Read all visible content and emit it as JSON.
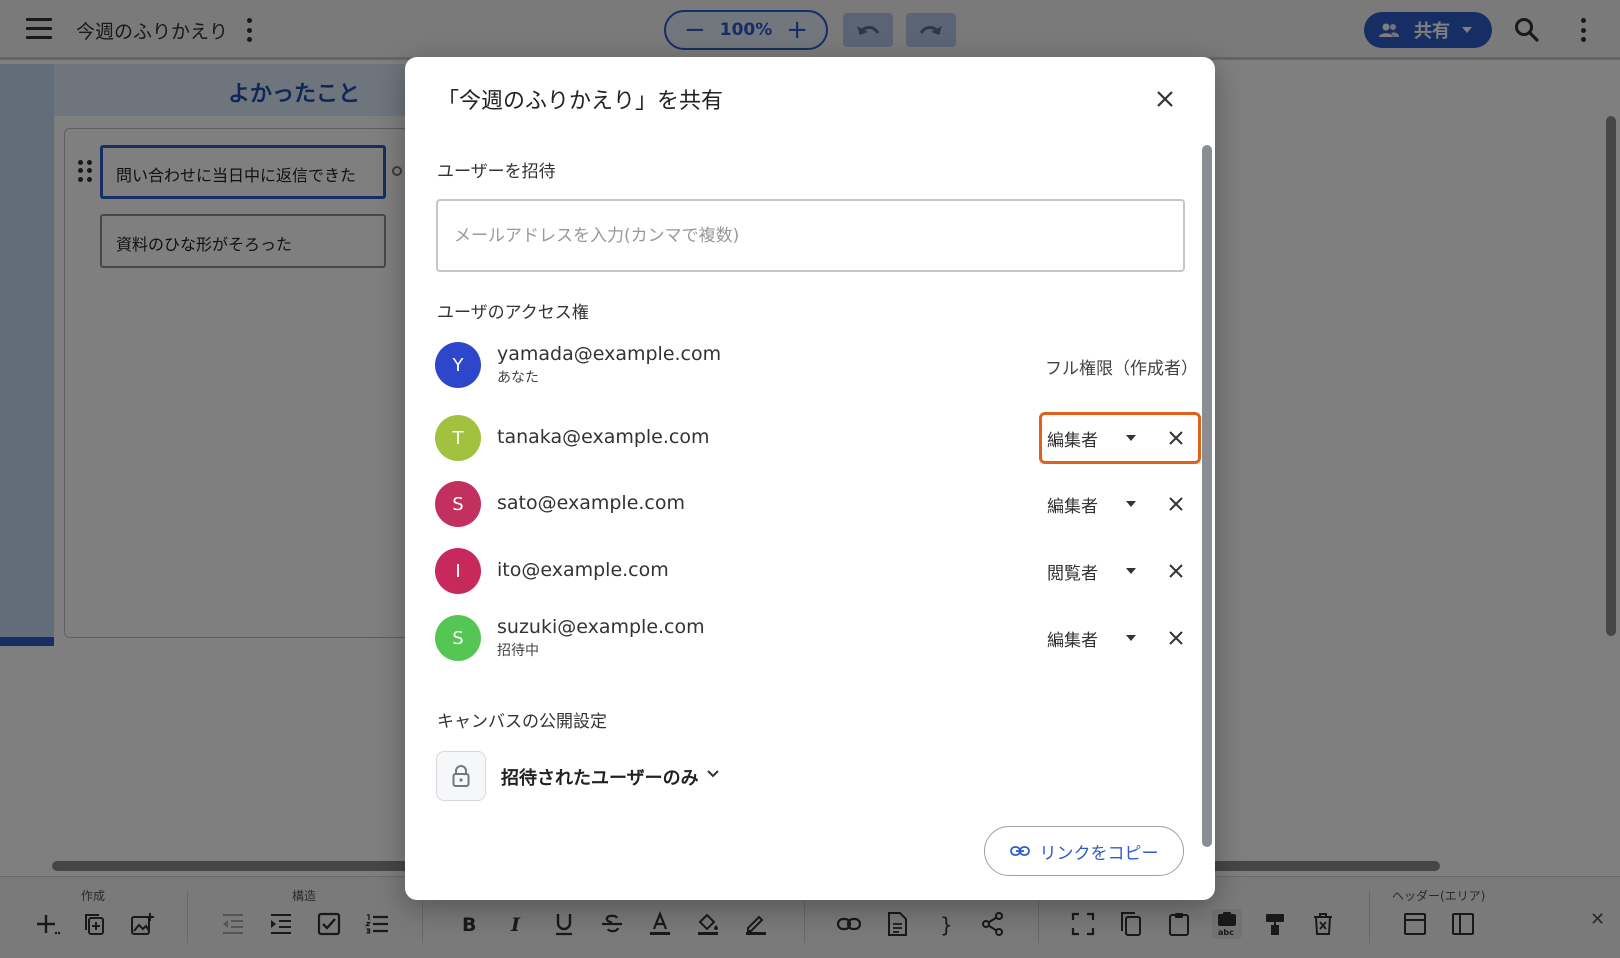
{
  "topbar": {
    "title": "今週のふりかえり",
    "zoom_minus": "−",
    "zoom_value": "100%",
    "zoom_plus": "+",
    "share_label": "共有"
  },
  "canvas": {
    "area_title": "よかったこと",
    "cards": [
      "問い合わせに当日中に返信できた",
      "資料のひな形がそろった"
    ]
  },
  "toolbar": {
    "groups": [
      "作成",
      "構造",
      "ヘッダー(エリア)"
    ],
    "icons": [
      "add-icon",
      "duplicate-icon",
      "add-image-icon",
      "outdent-icon",
      "indent-icon",
      "checkbox-icon",
      "numbered-list-icon",
      "bold-icon",
      "italic-icon",
      "underline-icon",
      "strikethrough-icon",
      "text-color-icon",
      "fill-color-icon",
      "pen-icon",
      "link-icon",
      "document-icon",
      "brace-icon",
      "share-node-icon",
      "fullscreen-icon",
      "copy-icon",
      "paste-icon",
      "paste-text-icon",
      "format-painter-icon",
      "delete-icon",
      "header-layout-icon",
      "sidebar-layout-icon"
    ]
  },
  "dialog": {
    "title": "「今週のふりかえり」を共有",
    "invite_label": "ユーザーを招待",
    "email_placeholder": "メールアドレスを入力(カンマで複数)",
    "access_label": "ユーザのアクセス権",
    "users": [
      {
        "initial": "Y",
        "email": "yamada@example.com",
        "sub": "あなた",
        "role": "フル権限（作成者）",
        "color": "#2c47c9"
      },
      {
        "initial": "T",
        "email": "tanaka@example.com",
        "sub": "",
        "role": "編集者",
        "color": "#a2c13f"
      },
      {
        "initial": "S",
        "email": "sato@example.com",
        "sub": "",
        "role": "編集者",
        "color": "#c2305f"
      },
      {
        "initial": "I",
        "email": "ito@example.com",
        "sub": "",
        "role": "閲覧者",
        "color": "#c8295c"
      },
      {
        "initial": "S",
        "email": "suzuki@example.com",
        "sub": "招待中",
        "role": "編集者",
        "color": "#55c653"
      }
    ],
    "visibility_label": "キャンバスの公開設定",
    "visibility_value": "招待されたユーザーのみ",
    "copy_link_label": "リンクをコピー"
  },
  "colors": {
    "accent": "#2d5cc9",
    "focus_outline": "#e0611c"
  }
}
